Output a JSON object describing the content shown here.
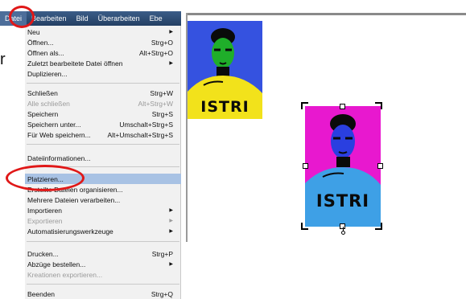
{
  "menubar": {
    "items": [
      "Datei",
      "Bearbeiten",
      "Bild",
      "Überarbeiten",
      "Ebe"
    ]
  },
  "stray_glyph": "r",
  "menu": {
    "items": [
      {
        "label": "Neu",
        "shortcut": ""
      },
      {
        "label": "Öffnen...",
        "shortcut": "Strg+O"
      },
      {
        "label": "Öffnen als...",
        "shortcut": "Alt+Strg+O"
      },
      {
        "label": "Zuletzt bearbeitete Datei öffnen",
        "shortcut": ""
      },
      {
        "label": "Duplizieren...",
        "shortcut": ""
      },
      {
        "label": "Schließen",
        "shortcut": "Strg+W"
      },
      {
        "label": "Alle schließen",
        "shortcut": "Alt+Strg+W"
      },
      {
        "label": "Speichern",
        "shortcut": "Strg+S"
      },
      {
        "label": "Speichern unter...",
        "shortcut": "Umschalt+Strg+S"
      },
      {
        "label": "Für Web speichern...",
        "shortcut": "Alt+Umschalt+Strg+S"
      },
      {
        "label": "Dateiinformationen...",
        "shortcut": ""
      },
      {
        "label": "Platzieren...",
        "shortcut": ""
      },
      {
        "label": "Erstellte Dateien organisieren...",
        "shortcut": ""
      },
      {
        "label": "Mehrere Dateien verarbeiten...",
        "shortcut": ""
      },
      {
        "label": "Importieren",
        "shortcut": ""
      },
      {
        "label": "Exportieren",
        "shortcut": ""
      },
      {
        "label": "Automatisierungswerkzeuge",
        "shortcut": ""
      },
      {
        "label": "Drucken...",
        "shortcut": "Strg+P"
      },
      {
        "label": "Abzüge bestellen...",
        "shortcut": ""
      },
      {
        "label": "Kreationen exportieren...",
        "shortcut": ""
      },
      {
        "label": "Beenden",
        "shortcut": "Strg+Q"
      }
    ]
  },
  "photos": {
    "sweater_text": "ISTRI"
  },
  "colors": {
    "menubar": "#2c4a73",
    "highlight": "#a8c2e4",
    "annotation": "#e01818",
    "photo1_bg": "#3552e0",
    "photo2_bg": "#e818cf"
  },
  "icons": {
    "submenu": "submenu-arrow-icon",
    "placed_image": "placed-image-icon"
  }
}
